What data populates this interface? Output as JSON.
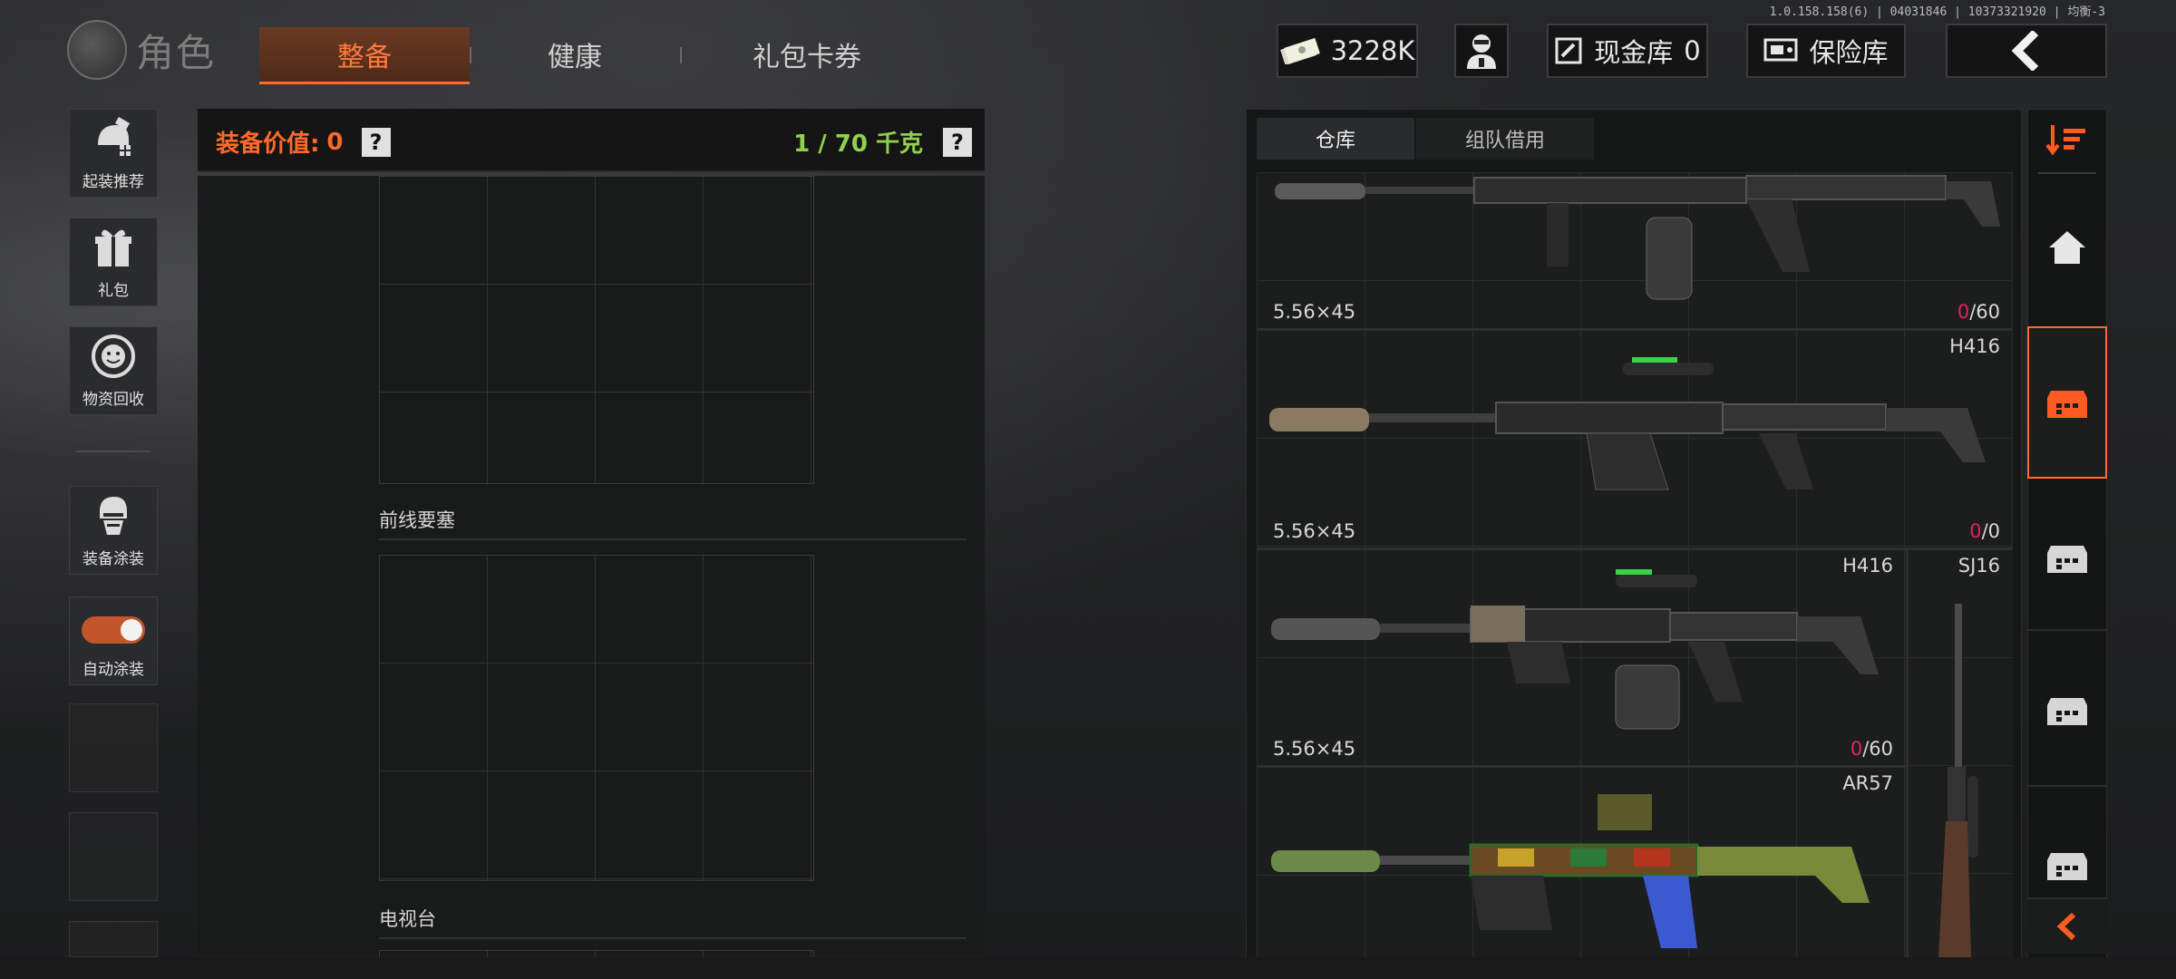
{
  "version": "1.0.158.158(6) | 04031846 | 10373321920 | 均衡-3",
  "header": {
    "title": "角色",
    "tabs": [
      {
        "label": "整备",
        "active": true
      },
      {
        "label": "健康",
        "active": false
      },
      {
        "label": "礼包卡券",
        "active": false
      }
    ],
    "currency": "3228K",
    "cash_vault_label": "现金库",
    "cash_vault_value": "0",
    "insurance_label": "保险库"
  },
  "left_sidebar": {
    "items": [
      {
        "label": "起装推荐",
        "icon": "helmet-preset-icon"
      },
      {
        "label": "礼包",
        "icon": "gift-icon"
      },
      {
        "label": "物资回收",
        "icon": "recycle-icon"
      },
      {
        "label": "装备涂装",
        "icon": "operator-skin-icon"
      },
      {
        "label": "自动涂装",
        "icon": "toggle-icon",
        "toggle_on": true
      }
    ]
  },
  "equipment": {
    "value_label": "装备价值:",
    "value": "0",
    "weight": "1 / 70 千克",
    "help": "?",
    "sections": [
      "前线要塞",
      "电视台"
    ]
  },
  "warehouse": {
    "tabs": [
      {
        "label": "仓库",
        "active": true
      },
      {
        "label": "组队借用",
        "active": false
      }
    ],
    "weapons": [
      {
        "name": "",
        "caliber": "5.56×45",
        "ammo_current": "0",
        "ammo_max": "/60"
      },
      {
        "name": "H416",
        "caliber": "5.56×45",
        "ammo_current": "0",
        "ammo_max": "/0"
      },
      {
        "name": "H416",
        "caliber": "5.56×45",
        "ammo_current": "0",
        "ammo_max": "/60"
      },
      {
        "name": "AR57",
        "caliber": "",
        "ammo_current": "",
        "ammo_max": ""
      },
      {
        "name": "SJ16",
        "caliber": "",
        "ammo_current": "",
        "ammo_max": ""
      }
    ]
  },
  "colors": {
    "accent": "#ff6a2a",
    "value_orange": "#ff6a2a",
    "weight_green": "#8fd14f",
    "ammo_red": "#e0245e"
  }
}
